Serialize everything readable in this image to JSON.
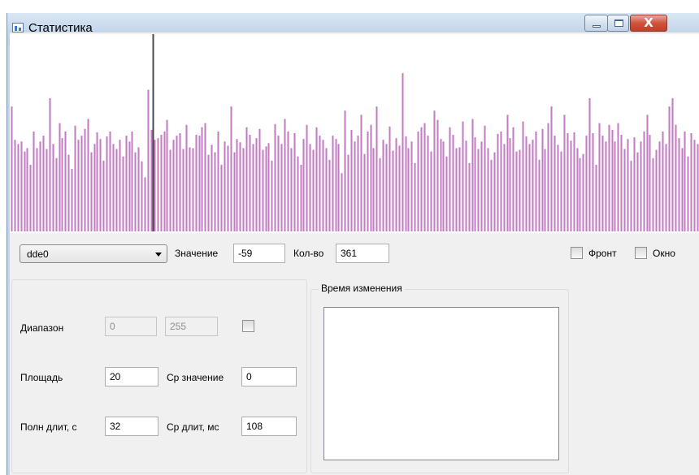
{
  "window": {
    "title": "Статистика",
    "close_glyph": "X"
  },
  "icons": {
    "app": "chart-app-icon",
    "minimize": "minimize-icon",
    "maximize": "maximize-icon",
    "close": "close-icon"
  },
  "colors": {
    "bar": "#c37ac3",
    "marker": "#4a4a4a",
    "window_frame": "#c4d7ea",
    "client": "#f0f0f0"
  },
  "chart_data": {
    "type": "bar",
    "values": [
      150,
      110,
      105,
      108,
      96,
      100,
      80,
      120,
      100,
      108,
      115,
      99,
      160,
      105,
      88,
      130,
      112,
      120,
      92,
      75,
      127,
      110,
      115,
      123,
      135,
      95,
      105,
      119,
      111,
      85,
      114,
      120,
      105,
      99,
      110,
      90,
      115,
      108,
      120,
      95,
      101,
      84,
      65,
      170,
      122,
      110,
      112,
      116,
      120,
      134,
      98,
      110,
      115,
      118,
      99,
      128,
      101,
      100,
      116,
      115,
      125,
      130,
      92,
      104,
      95,
      120,
      80,
      108,
      103,
      150,
      95,
      111,
      107,
      100,
      125,
      116,
      105,
      112,
      123,
      98,
      102,
      106,
      85,
      129,
      115,
      105,
      135,
      120,
      100,
      118,
      90,
      80,
      111,
      128,
      105,
      98,
      125,
      115,
      110,
      100,
      86,
      115,
      111,
      105,
      70,
      145,
      92,
      122,
      108,
      115,
      140,
      93,
      120,
      128,
      100,
      150,
      88,
      110,
      105,
      126,
      97,
      112,
      103,
      190,
      114,
      100,
      108,
      82,
      120,
      125,
      130,
      115,
      96,
      145,
      134,
      111,
      108,
      90,
      125,
      116,
      100,
      101,
      132,
      109,
      82,
      135,
      113,
      99,
      108,
      127,
      100,
      86,
      95,
      117,
      120,
      105,
      140,
      112,
      125,
      96,
      98,
      132,
      114,
      105,
      110,
      120,
      86,
      123,
      99,
      130,
      150,
      115,
      104,
      96,
      140,
      118,
      109,
      119,
      100,
      88,
      93,
      115,
      160,
      118,
      80,
      130,
      115,
      108,
      128,
      122,
      108,
      130,
      116,
      99,
      111,
      85,
      113,
      95,
      108,
      120,
      140,
      116,
      88,
      98,
      108,
      120,
      105,
      150,
      160,
      128,
      112,
      100,
      120,
      90,
      118,
      110,
      105
    ],
    "marker_index": 45,
    "ylim": [
      0,
      235
    ],
    "grid": false
  },
  "toolbar": {
    "channel_selected": "dde0",
    "value_label": "Значение",
    "value": "-59",
    "count_label": "Кол-во",
    "count": "361",
    "front_label": "Фронт",
    "window_label": "Окно"
  },
  "params": {
    "range_label": "Диапазон",
    "range_min": "0",
    "range_max": "255",
    "area_label": "Площадь",
    "area": "20",
    "avg_value_label": "Ср значение",
    "avg_value": "0",
    "total_dur_label": "Полн длит, с",
    "total_dur": "32",
    "avg_dur_label": "Ср длит, мс",
    "avg_dur": "108"
  },
  "change_time": {
    "title": "Время изменения"
  }
}
